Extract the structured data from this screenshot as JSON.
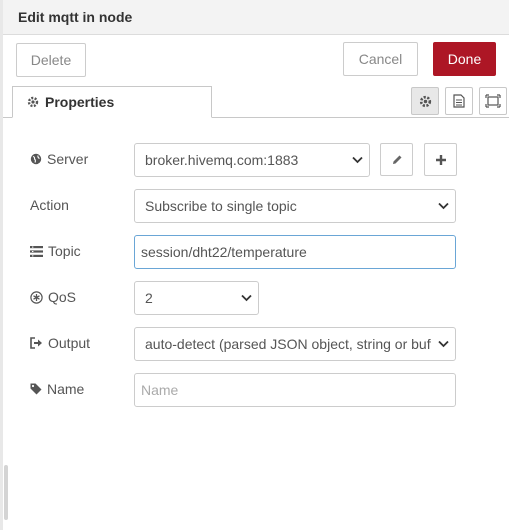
{
  "dialog": {
    "title": "Edit mqtt in node"
  },
  "toolbar": {
    "delete_label": "Delete",
    "cancel_label": "Cancel",
    "done_label": "Done"
  },
  "tabs": {
    "properties_label": "Properties",
    "icons": [
      "gear-icon",
      "document-icon",
      "frame-icon"
    ]
  },
  "form": {
    "server": {
      "label": "Server",
      "value": "broker.hivemq.com:1883",
      "edit_icon": "pencil-icon",
      "add_icon": "plus-icon"
    },
    "action": {
      "label": "Action",
      "value": "Subscribe to single topic"
    },
    "topic": {
      "label": "Topic",
      "value": "session/dht22/temperature"
    },
    "qos": {
      "label": "QoS",
      "value": "2"
    },
    "output": {
      "label": "Output",
      "value": "auto-detect (parsed JSON object, string or buffer)"
    },
    "name": {
      "label": "Name",
      "value": "",
      "placeholder": "Name"
    }
  },
  "colors": {
    "done": "#ad1625",
    "focus": "#6aa6d6",
    "titlebar": "#f3f3f3"
  }
}
